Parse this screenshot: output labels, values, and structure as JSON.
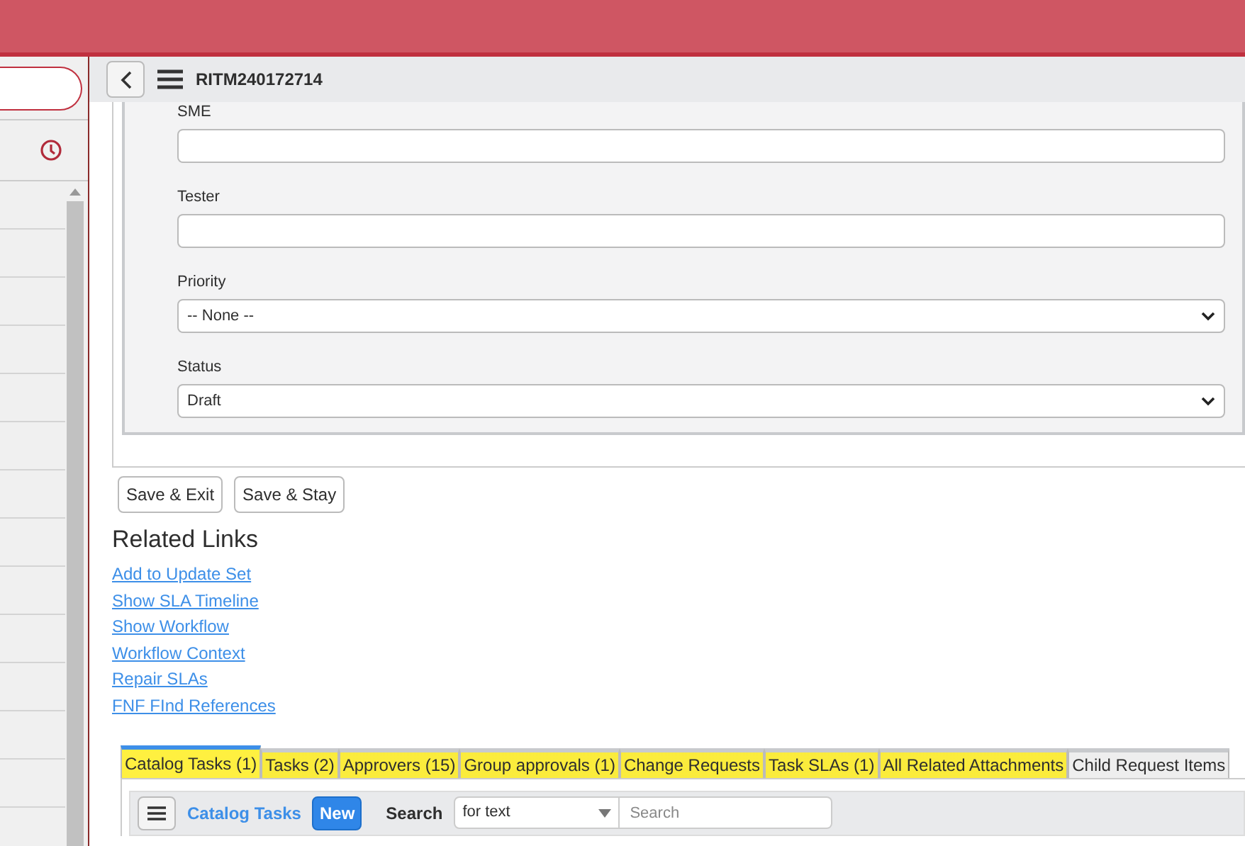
{
  "header": {
    "title": "RITM240172714"
  },
  "form": {
    "fields": [
      {
        "label": "SME",
        "kind": "text"
      },
      {
        "label": "Tester",
        "kind": "text"
      },
      {
        "label": "Priority",
        "kind": "select",
        "value": "-- None --"
      },
      {
        "label": "Status",
        "kind": "select",
        "value": "Draft"
      }
    ],
    "buttons": [
      "Save & Exit",
      "Save & Stay"
    ]
  },
  "related_links": {
    "title": "Related Links",
    "links": [
      "Add to Update Set",
      "Show SLA Timeline",
      "Show Workflow",
      "Workflow Context",
      "Repair SLAs",
      "FNF FInd References"
    ]
  },
  "related_lists": {
    "tabs": [
      {
        "label": "Catalog Tasks (1)",
        "selected": true,
        "highlighted": true
      },
      {
        "label": "Tasks (2)",
        "selected": false,
        "highlighted": true
      },
      {
        "label": "Approvers (15)",
        "selected": false,
        "highlighted": true
      },
      {
        "label": "Group approvals (1)",
        "selected": false,
        "highlighted": true
      },
      {
        "label": "Change Requests",
        "selected": false,
        "highlighted": true
      },
      {
        "label": "Task SLAs (1)",
        "selected": false,
        "highlighted": true
      },
      {
        "label": "All Related Attachments",
        "selected": false,
        "highlighted": true
      },
      {
        "label": "Child Request Items",
        "selected": false,
        "highlighted": false
      }
    ],
    "toolbar": {
      "title": "Catalog Tasks",
      "new_button": "New",
      "search_label": "Search",
      "search_field": "for text",
      "search_placeholder": "Search"
    }
  }
}
